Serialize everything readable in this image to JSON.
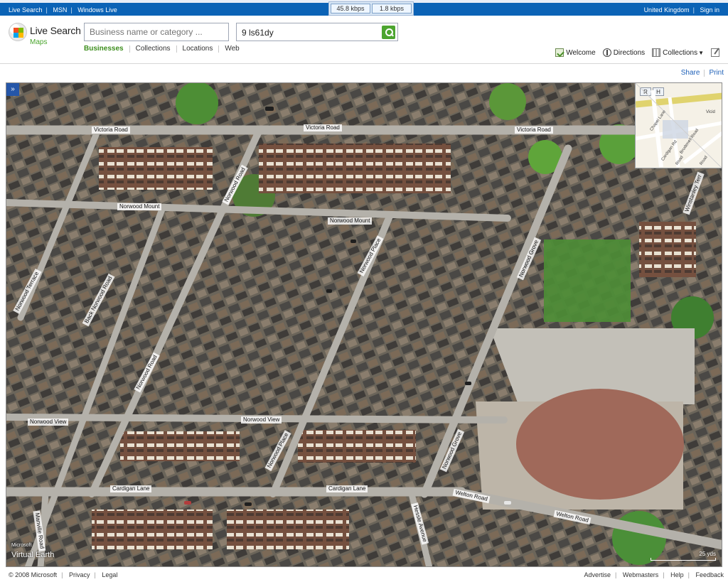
{
  "topbar": {
    "links_left": [
      "Live Search",
      "MSN",
      "Windows Live"
    ],
    "links_right": [
      "United Kingdom",
      "Sign in"
    ],
    "speed_down": "45.8 kbps",
    "speed_up": "1.8 kbps"
  },
  "brand": {
    "name": "Live Search",
    "sub": "Maps"
  },
  "search": {
    "business_placeholder": "Business name or category ...",
    "location_value": "9 ls61dy"
  },
  "tabs": [
    "Businesses",
    "Collections",
    "Locations",
    "Web"
  ],
  "tools": {
    "welcome": "Welcome",
    "directions": "Directions",
    "collections": "Collections"
  },
  "actions": {
    "share": "Share",
    "print": "Print"
  },
  "map": {
    "streets": [
      "Victoria Road",
      "Victoria Road",
      "Victoria Road",
      "Norwood Mount",
      "Norwood Mount",
      "Norwood Road",
      "Norwood Terrace",
      "Back Norwood Road",
      "Norwood Road",
      "Norwood Place",
      "Norwood Grove",
      "Winstanley Terr",
      "Norwood View",
      "Norwood View",
      "Norwood Place",
      "Norwood Grove",
      "Cardigan Lane",
      "Cardigan Lane",
      "Welton Road",
      "Welton Road",
      "Hessle Avenue",
      "Manville Road"
    ],
    "minimap": {
      "buttons": [
        "R",
        "H"
      ],
      "labels": [
        "Chapel Lane",
        "Cardigan Rd",
        "Brudenell Road",
        "Road",
        "Vicid",
        "Road"
      ]
    },
    "brand_small": "Microsoft",
    "brand_big": "Virtual Earth",
    "scale": "25 yds"
  },
  "footer": {
    "left": [
      "© 2008 Microsoft",
      "Privacy",
      "Legal"
    ],
    "right": [
      "Advertise",
      "Webmasters",
      "Help",
      "Feedback"
    ]
  }
}
